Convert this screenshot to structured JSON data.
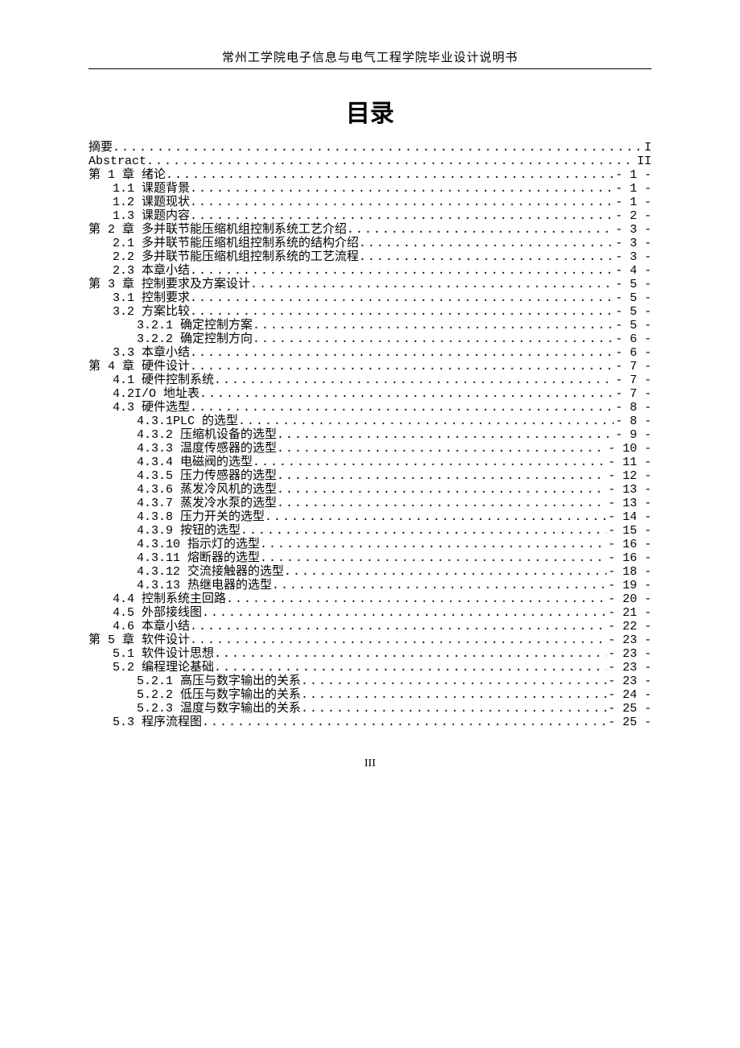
{
  "header": "常州工学院电子信息与电气工程学院毕业设计说明书",
  "title": "目录",
  "footer": "III",
  "toc": [
    {
      "level": 0,
      "label": "摘要",
      "page": "I"
    },
    {
      "level": 0,
      "label": "Abstract",
      "page": "II"
    },
    {
      "level": 0,
      "label": "第 1 章 绪论",
      "page": "- 1 -"
    },
    {
      "level": 1,
      "label": "1.1 课题背景",
      "page": "- 1 -"
    },
    {
      "level": 1,
      "label": "1.2 课题现状",
      "page": "- 1 -"
    },
    {
      "level": 1,
      "label": "1.3 课题内容",
      "page": "- 2 -"
    },
    {
      "level": 0,
      "label": "第 2 章 多并联节能压缩机组控制系统工艺介绍",
      "page": "- 3 -"
    },
    {
      "level": 1,
      "label": "2.1 多并联节能压缩机组控制系统的结构介绍",
      "page": "- 3 -"
    },
    {
      "level": 1,
      "label": "2.2 多并联节能压缩机组控制系统的工艺流程",
      "page": "- 3 -"
    },
    {
      "level": 1,
      "label": "2.3 本章小结",
      "page": "- 4 -"
    },
    {
      "level": 0,
      "label": "第 3 章 控制要求及方案设计",
      "page": "- 5 -"
    },
    {
      "level": 1,
      "label": "3.1 控制要求",
      "page": "- 5 -"
    },
    {
      "level": 1,
      "label": "3.2 方案比较",
      "page": "- 5 -"
    },
    {
      "level": 2,
      "label": "3.2.1 确定控制方案",
      "page": "- 5 -"
    },
    {
      "level": 2,
      "label": "3.2.2 确定控制方向",
      "page": "- 6 -"
    },
    {
      "level": 1,
      "label": "3.3 本章小结",
      "page": "- 6 -"
    },
    {
      "level": 0,
      "label": "第 4 章 硬件设计",
      "page": "- 7 -"
    },
    {
      "level": 1,
      "label": "4.1 硬件控制系统",
      "page": "- 7 -"
    },
    {
      "level": 1,
      "label": "4.2I/O 地址表",
      "page": "- 7 -"
    },
    {
      "level": 1,
      "label": "4.3 硬件选型",
      "page": "- 8 -"
    },
    {
      "level": 2,
      "label": "4.3.1PLC 的选型",
      "page": "- 8 -"
    },
    {
      "level": 2,
      "label": "4.3.2 压缩机设备的选型",
      "page": "- 9 -"
    },
    {
      "level": 2,
      "label": "4.3.3 温度传感器的选型",
      "page": "- 10 -"
    },
    {
      "level": 2,
      "label": "4.3.4 电磁阀的选型",
      "page": "- 11 -"
    },
    {
      "level": 2,
      "label": "4.3.5 压力传感器的选型",
      "page": "- 12 -"
    },
    {
      "level": 2,
      "label": "4.3.6 蒸发冷风机的选型",
      "page": "- 13 -"
    },
    {
      "level": 2,
      "label": "4.3.7 蒸发冷水泵的选型",
      "page": "- 13 -"
    },
    {
      "level": 2,
      "label": "4.3.8 压力开关的选型",
      "page": "- 14 -"
    },
    {
      "level": 2,
      "label": "4.3.9 按钮的选型",
      "page": "- 15 -"
    },
    {
      "level": 2,
      "label": "4.3.10 指示灯的选型",
      "page": "- 16 -"
    },
    {
      "level": 2,
      "label": "4.3.11 熔断器的选型",
      "page": "- 16 -"
    },
    {
      "level": 2,
      "label": "4.3.12 交流接触器的选型",
      "page": "- 18 -"
    },
    {
      "level": 2,
      "label": "4.3.13 热继电器的选型",
      "page": "- 19 -"
    },
    {
      "level": 1,
      "label": "4.4 控制系统主回路",
      "page": "- 20 -"
    },
    {
      "level": 1,
      "label": "4.5 外部接线图",
      "page": "- 21 -"
    },
    {
      "level": 1,
      "label": "4.6 本章小结",
      "page": "- 22 -"
    },
    {
      "level": 0,
      "label": "第 5 章 软件设计",
      "page": "- 23 -"
    },
    {
      "level": 1,
      "label": "5.1 软件设计思想",
      "page": "- 23 -"
    },
    {
      "level": 1,
      "label": "5.2 编程理论基础",
      "page": "- 23 -"
    },
    {
      "level": 2,
      "label": "5.2.1 高压与数字输出的关系",
      "page": "- 23 -"
    },
    {
      "level": 2,
      "label": "5.2.2 低压与数字输出的关系",
      "page": "- 24 -"
    },
    {
      "level": 2,
      "label": "5.2.3 温度与数字输出的关系",
      "page": "- 25 -"
    },
    {
      "level": 1,
      "label": "5.3 程序流程图",
      "page": "- 25 -"
    }
  ]
}
